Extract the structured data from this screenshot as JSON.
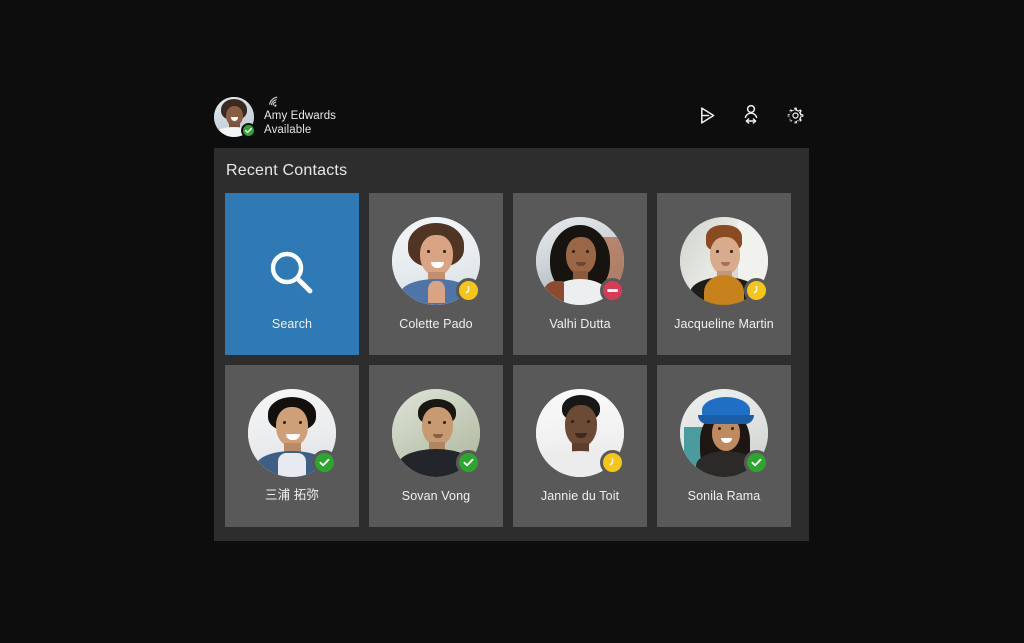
{
  "window": {
    "background_color": "#0d0d0d"
  },
  "header": {
    "user": {
      "name": "Amy Edwards",
      "status": "Available",
      "status_badge": "available-check-icon",
      "avatar": "user-avatar",
      "signal_icon": "wifi-icon"
    },
    "actions": [
      {
        "name": "send-icon",
        "label": "Send"
      },
      {
        "name": "switch-user-icon",
        "label": "Switch User"
      },
      {
        "name": "settings-gear-icon",
        "label": "Settings"
      }
    ]
  },
  "panel": {
    "title": "Recent Contacts",
    "background_color": "#2d2d2d",
    "tile_color": "#595959",
    "search_tile": {
      "label": "Search",
      "icon": "search-icon",
      "color": "#2f7ab4"
    },
    "status_colors": {
      "available": "#2ea52e",
      "away": "#f5c518",
      "busy": "#d93b55"
    },
    "contacts": [
      {
        "name": "Colette Pado",
        "status": "away",
        "status_icon": "clock-icon"
      },
      {
        "name": "Valhi Dutta",
        "status": "busy",
        "status_icon": "dash-icon"
      },
      {
        "name": "Jacqueline Martin",
        "status": "away",
        "status_icon": "clock-icon"
      },
      {
        "name": "三浦 拓弥",
        "status": "available",
        "status_icon": "check-icon"
      },
      {
        "name": "Sovan Vong",
        "status": "available",
        "status_icon": "check-icon"
      },
      {
        "name": "Jannie du Toit",
        "status": "away",
        "status_icon": "clock-icon"
      },
      {
        "name": "Sonila Rama",
        "status": "available",
        "status_icon": "check-icon"
      }
    ]
  }
}
